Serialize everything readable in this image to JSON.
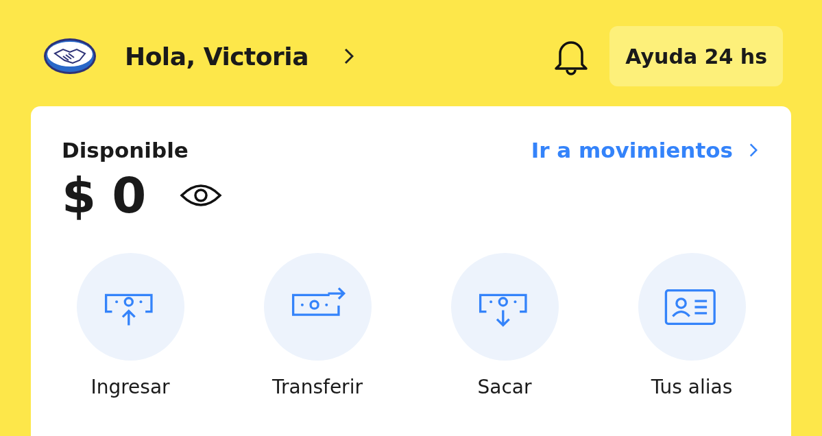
{
  "header": {
    "greeting": "Hola, Victoria",
    "help_button": "Ayuda 24 hs"
  },
  "balance": {
    "label": "Disponible",
    "link": "Ir a movimientos",
    "amount": "$ 0"
  },
  "actions": [
    {
      "label": "Ingresar",
      "kind": "deposit"
    },
    {
      "label": "Transferir",
      "kind": "transfer"
    },
    {
      "label": "Sacar",
      "kind": "withdraw"
    },
    {
      "label": "Tus alias",
      "kind": "alias"
    }
  ]
}
